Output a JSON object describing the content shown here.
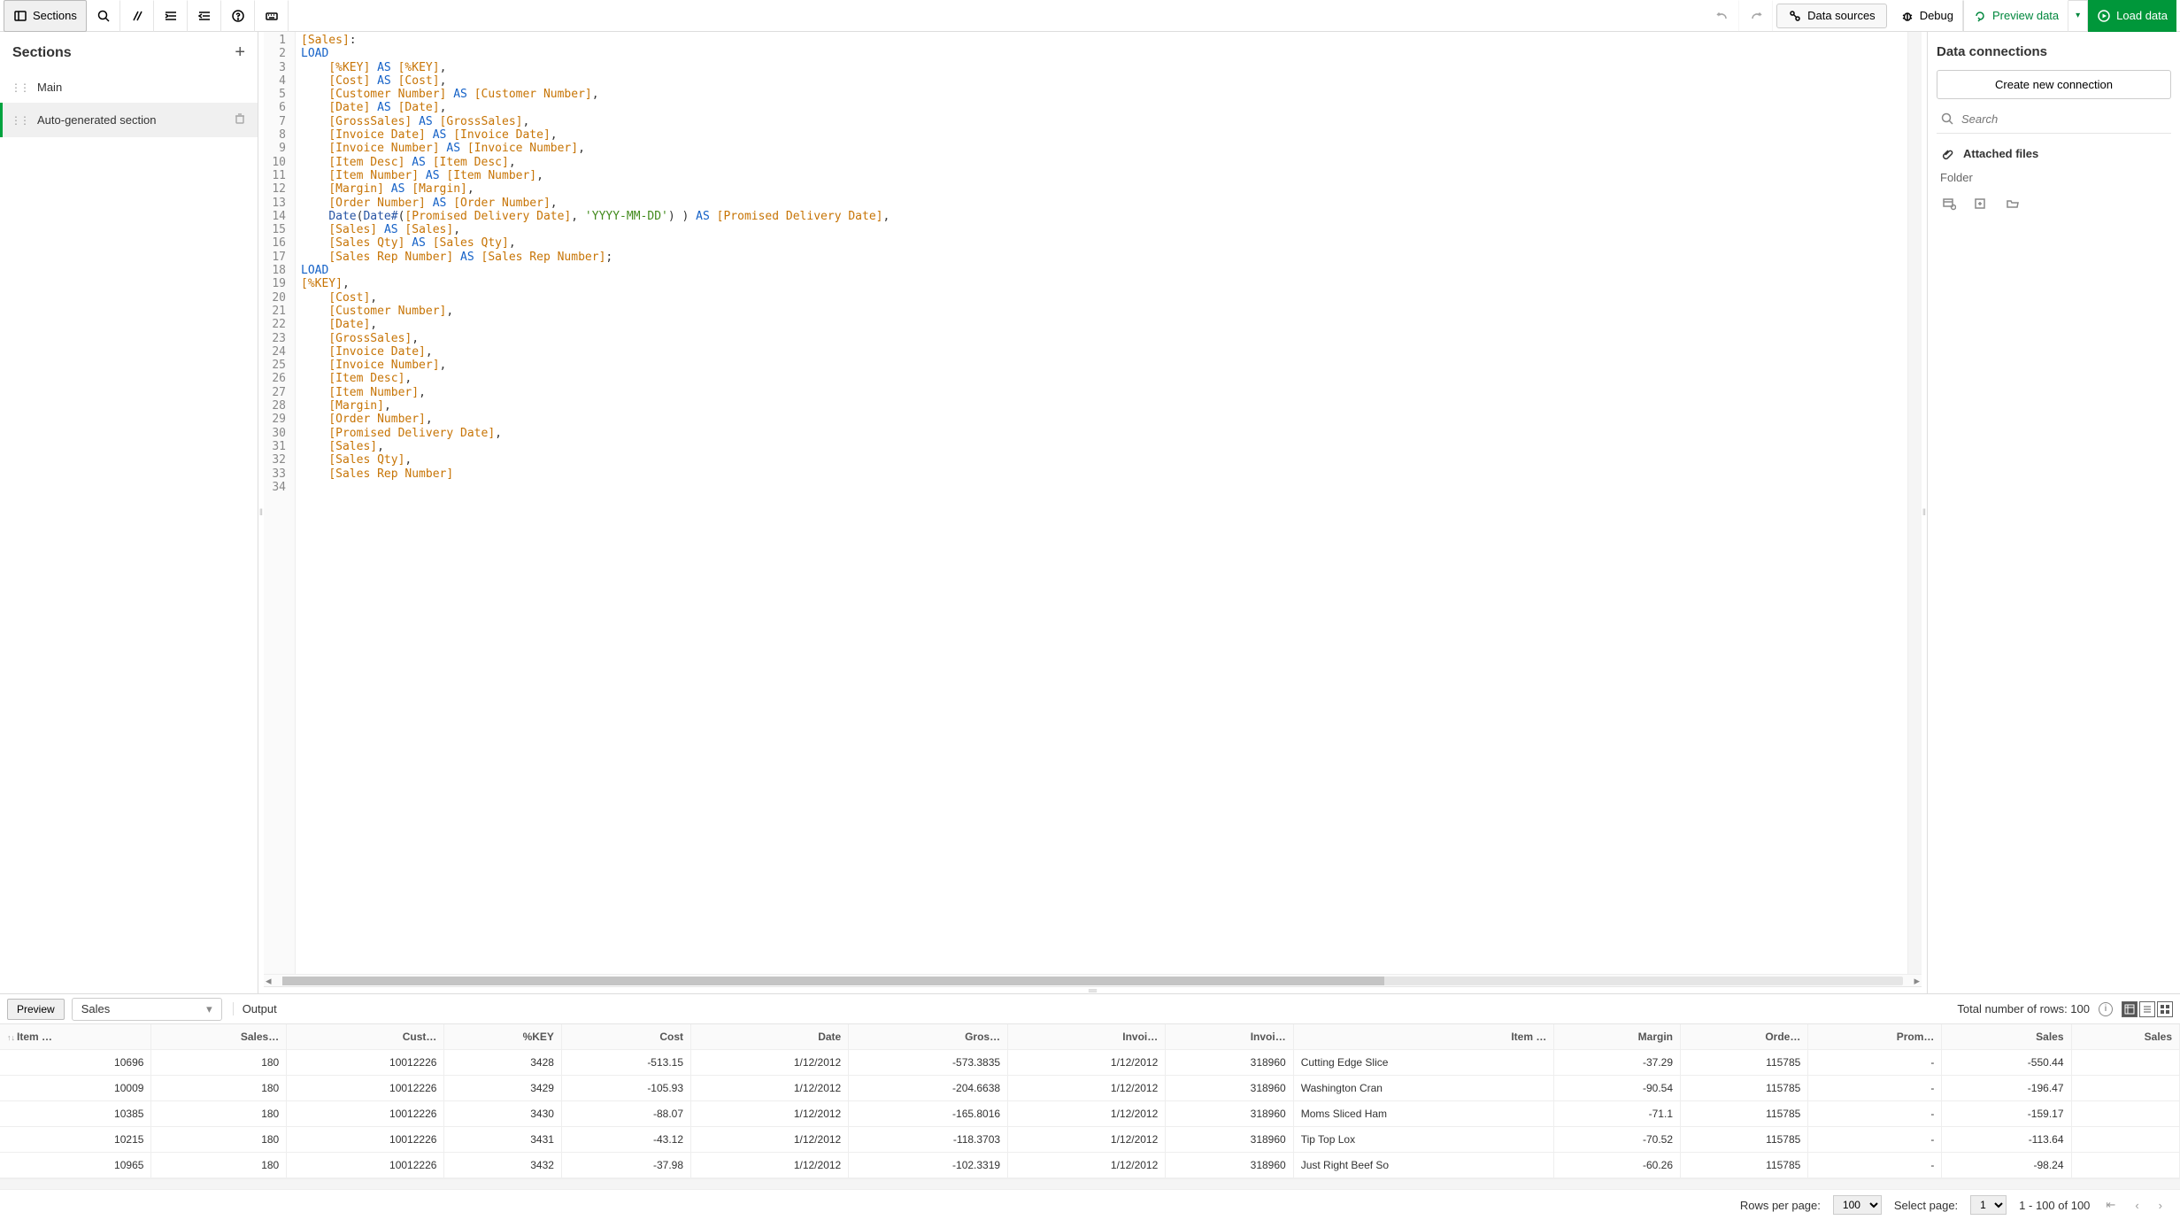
{
  "toolbar": {
    "sections_label": "Sections",
    "data_sources_label": "Data sources",
    "debug_label": "Debug",
    "preview_data_label": "Preview data",
    "load_data_label": "Load data"
  },
  "left_panel": {
    "title": "Sections",
    "items": [
      {
        "label": "Main",
        "selected": false
      },
      {
        "label": "Auto-generated section",
        "selected": true
      }
    ]
  },
  "right_panel": {
    "title": "Data connections",
    "create_btn": "Create new connection",
    "search_placeholder": "Search",
    "attached_label": "Attached files",
    "folder_label": "Folder"
  },
  "code": {
    "lines": [
      {
        "n": 1,
        "tokens": [
          {
            "t": "[Sales]",
            "c": "orange"
          },
          {
            "t": ":",
            "c": ""
          }
        ]
      },
      {
        "n": 2,
        "tokens": [
          {
            "t": "LOAD",
            "c": "blue"
          }
        ]
      },
      {
        "n": 3,
        "tokens": [
          {
            "t": "    ",
            "c": ""
          },
          {
            "t": "[%KEY]",
            "c": "orange"
          },
          {
            "t": " ",
            "c": ""
          },
          {
            "t": "AS",
            "c": "blue"
          },
          {
            "t": " ",
            "c": ""
          },
          {
            "t": "[%KEY]",
            "c": "orange"
          },
          {
            "t": ",",
            "c": ""
          }
        ]
      },
      {
        "n": 4,
        "tokens": [
          {
            "t": "    ",
            "c": ""
          },
          {
            "t": "[Cost]",
            "c": "orange"
          },
          {
            "t": " ",
            "c": ""
          },
          {
            "t": "AS",
            "c": "blue"
          },
          {
            "t": " ",
            "c": ""
          },
          {
            "t": "[Cost]",
            "c": "orange"
          },
          {
            "t": ",",
            "c": ""
          }
        ]
      },
      {
        "n": 5,
        "tokens": [
          {
            "t": "    ",
            "c": ""
          },
          {
            "t": "[Customer Number]",
            "c": "orange"
          },
          {
            "t": " ",
            "c": ""
          },
          {
            "t": "AS",
            "c": "blue"
          },
          {
            "t": " ",
            "c": ""
          },
          {
            "t": "[Customer Number]",
            "c": "orange"
          },
          {
            "t": ",",
            "c": ""
          }
        ]
      },
      {
        "n": 6,
        "tokens": [
          {
            "t": "    ",
            "c": ""
          },
          {
            "t": "[Date]",
            "c": "orange"
          },
          {
            "t": " ",
            "c": ""
          },
          {
            "t": "AS",
            "c": "blue"
          },
          {
            "t": " ",
            "c": ""
          },
          {
            "t": "[Date]",
            "c": "orange"
          },
          {
            "t": ",",
            "c": ""
          }
        ]
      },
      {
        "n": 7,
        "tokens": [
          {
            "t": "    ",
            "c": ""
          },
          {
            "t": "[GrossSales]",
            "c": "orange"
          },
          {
            "t": " ",
            "c": ""
          },
          {
            "t": "AS",
            "c": "blue"
          },
          {
            "t": " ",
            "c": ""
          },
          {
            "t": "[GrossSales]",
            "c": "orange"
          },
          {
            "t": ",",
            "c": ""
          }
        ]
      },
      {
        "n": 8,
        "tokens": [
          {
            "t": "    ",
            "c": ""
          },
          {
            "t": "[Invoice Date]",
            "c": "orange"
          },
          {
            "t": " ",
            "c": ""
          },
          {
            "t": "AS",
            "c": "blue"
          },
          {
            "t": " ",
            "c": ""
          },
          {
            "t": "[Invoice Date]",
            "c": "orange"
          },
          {
            "t": ",",
            "c": ""
          }
        ]
      },
      {
        "n": 9,
        "tokens": [
          {
            "t": "    ",
            "c": ""
          },
          {
            "t": "[Invoice Number]",
            "c": "orange"
          },
          {
            "t": " ",
            "c": ""
          },
          {
            "t": "AS",
            "c": "blue"
          },
          {
            "t": " ",
            "c": ""
          },
          {
            "t": "[Invoice Number]",
            "c": "orange"
          },
          {
            "t": ",",
            "c": ""
          }
        ]
      },
      {
        "n": 10,
        "tokens": [
          {
            "t": "    ",
            "c": ""
          },
          {
            "t": "[Item Desc]",
            "c": "orange"
          },
          {
            "t": " ",
            "c": ""
          },
          {
            "t": "AS",
            "c": "blue"
          },
          {
            "t": " ",
            "c": ""
          },
          {
            "t": "[Item Desc]",
            "c": "orange"
          },
          {
            "t": ",",
            "c": ""
          }
        ]
      },
      {
        "n": 11,
        "tokens": [
          {
            "t": "    ",
            "c": ""
          },
          {
            "t": "[Item Number]",
            "c": "orange"
          },
          {
            "t": " ",
            "c": ""
          },
          {
            "t": "AS",
            "c": "blue"
          },
          {
            "t": " ",
            "c": ""
          },
          {
            "t": "[Item Number]",
            "c": "orange"
          },
          {
            "t": ",",
            "c": ""
          }
        ]
      },
      {
        "n": 12,
        "tokens": [
          {
            "t": "    ",
            "c": ""
          },
          {
            "t": "[Margin]",
            "c": "orange"
          },
          {
            "t": " ",
            "c": ""
          },
          {
            "t": "AS",
            "c": "blue"
          },
          {
            "t": " ",
            "c": ""
          },
          {
            "t": "[Margin]",
            "c": "orange"
          },
          {
            "t": ",",
            "c": ""
          }
        ]
      },
      {
        "n": 13,
        "tokens": [
          {
            "t": "    ",
            "c": ""
          },
          {
            "t": "[Order Number]",
            "c": "orange"
          },
          {
            "t": " ",
            "c": ""
          },
          {
            "t": "AS",
            "c": "blue"
          },
          {
            "t": " ",
            "c": ""
          },
          {
            "t": "[Order Number]",
            "c": "orange"
          },
          {
            "t": ",",
            "c": ""
          }
        ]
      },
      {
        "n": 14,
        "tokens": [
          {
            "t": "    ",
            "c": ""
          },
          {
            "t": "Date",
            "c": "dblue"
          },
          {
            "t": "(",
            "c": ""
          },
          {
            "t": "Date#",
            "c": "dblue"
          },
          {
            "t": "(",
            "c": ""
          },
          {
            "t": "[Promised Delivery Date]",
            "c": "orange"
          },
          {
            "t": ", ",
            "c": ""
          },
          {
            "t": "'YYYY-MM-DD'",
            "c": "green"
          },
          {
            "t": ") ) ",
            "c": ""
          },
          {
            "t": "AS",
            "c": "blue"
          },
          {
            "t": " ",
            "c": ""
          },
          {
            "t": "[Promised Delivery Date]",
            "c": "orange"
          },
          {
            "t": ",",
            "c": ""
          }
        ]
      },
      {
        "n": 15,
        "tokens": [
          {
            "t": "    ",
            "c": ""
          },
          {
            "t": "[Sales]",
            "c": "orange"
          },
          {
            "t": " ",
            "c": ""
          },
          {
            "t": "AS",
            "c": "blue"
          },
          {
            "t": " ",
            "c": ""
          },
          {
            "t": "[Sales]",
            "c": "orange"
          },
          {
            "t": ",",
            "c": ""
          }
        ]
      },
      {
        "n": 16,
        "tokens": [
          {
            "t": "    ",
            "c": ""
          },
          {
            "t": "[Sales Qty]",
            "c": "orange"
          },
          {
            "t": " ",
            "c": ""
          },
          {
            "t": "AS",
            "c": "blue"
          },
          {
            "t": " ",
            "c": ""
          },
          {
            "t": "[Sales Qty]",
            "c": "orange"
          },
          {
            "t": ",",
            "c": ""
          }
        ]
      },
      {
        "n": 17,
        "tokens": [
          {
            "t": "    ",
            "c": ""
          },
          {
            "t": "[Sales Rep Number]",
            "c": "orange"
          },
          {
            "t": " ",
            "c": ""
          },
          {
            "t": "AS",
            "c": "blue"
          },
          {
            "t": " ",
            "c": ""
          },
          {
            "t": "[Sales Rep Number]",
            "c": "orange"
          },
          {
            "t": ";",
            "c": ""
          }
        ]
      },
      {
        "n": 18,
        "tokens": [
          {
            "t": "LOAD",
            "c": "blue"
          }
        ]
      },
      {
        "n": 19,
        "tokens": [
          {
            "t": "[%KEY]",
            "c": "orange"
          },
          {
            "t": ",",
            "c": ""
          }
        ]
      },
      {
        "n": 20,
        "tokens": [
          {
            "t": "    ",
            "c": ""
          },
          {
            "t": "[Cost]",
            "c": "orange"
          },
          {
            "t": ",",
            "c": ""
          }
        ]
      },
      {
        "n": 21,
        "tokens": [
          {
            "t": "    ",
            "c": ""
          },
          {
            "t": "[Customer Number]",
            "c": "orange"
          },
          {
            "t": ",",
            "c": ""
          }
        ]
      },
      {
        "n": 22,
        "tokens": [
          {
            "t": "    ",
            "c": ""
          },
          {
            "t": "[Date]",
            "c": "orange"
          },
          {
            "t": ",",
            "c": ""
          }
        ]
      },
      {
        "n": 23,
        "tokens": [
          {
            "t": "    ",
            "c": ""
          },
          {
            "t": "[GrossSales]",
            "c": "orange"
          },
          {
            "t": ",",
            "c": ""
          }
        ]
      },
      {
        "n": 24,
        "tokens": [
          {
            "t": "    ",
            "c": ""
          },
          {
            "t": "[Invoice Date]",
            "c": "orange"
          },
          {
            "t": ",",
            "c": ""
          }
        ]
      },
      {
        "n": 25,
        "tokens": [
          {
            "t": "    ",
            "c": ""
          },
          {
            "t": "[Invoice Number]",
            "c": "orange"
          },
          {
            "t": ",",
            "c": ""
          }
        ]
      },
      {
        "n": 26,
        "tokens": [
          {
            "t": "    ",
            "c": ""
          },
          {
            "t": "[Item Desc]",
            "c": "orange"
          },
          {
            "t": ",",
            "c": ""
          }
        ]
      },
      {
        "n": 27,
        "tokens": [
          {
            "t": "    ",
            "c": ""
          },
          {
            "t": "[Item Number]",
            "c": "orange"
          },
          {
            "t": ",",
            "c": ""
          }
        ]
      },
      {
        "n": 28,
        "tokens": [
          {
            "t": "    ",
            "c": ""
          },
          {
            "t": "[Margin]",
            "c": "orange"
          },
          {
            "t": ",",
            "c": ""
          }
        ]
      },
      {
        "n": 29,
        "tokens": [
          {
            "t": "    ",
            "c": ""
          },
          {
            "t": "[Order Number]",
            "c": "orange"
          },
          {
            "t": ",",
            "c": ""
          }
        ]
      },
      {
        "n": 30,
        "tokens": [
          {
            "t": "    ",
            "c": ""
          },
          {
            "t": "[Promised Delivery Date]",
            "c": "orange"
          },
          {
            "t": ",",
            "c": ""
          }
        ]
      },
      {
        "n": 31,
        "tokens": [
          {
            "t": "    ",
            "c": ""
          },
          {
            "t": "[Sales]",
            "c": "orange"
          },
          {
            "t": ",",
            "c": ""
          }
        ]
      },
      {
        "n": 32,
        "tokens": [
          {
            "t": "    ",
            "c": ""
          },
          {
            "t": "[Sales Qty]",
            "c": "orange"
          },
          {
            "t": ",",
            "c": ""
          }
        ]
      },
      {
        "n": 33,
        "tokens": [
          {
            "t": "    ",
            "c": ""
          },
          {
            "t": "[Sales Rep Number]",
            "c": "orange"
          }
        ]
      },
      {
        "n": 34,
        "tokens": [
          {
            "t": "",
            "c": ""
          }
        ]
      }
    ]
  },
  "preview": {
    "preview_btn": "Preview",
    "table_selected": "Sales",
    "output_label": "Output",
    "rows_info": "Total number of rows: 100",
    "columns": [
      "Item …",
      "Sales…",
      "Cust…",
      "%KEY",
      "Cost",
      "Date",
      "Gros…",
      "Invoi…",
      "Invoi…",
      "Item …",
      "Margin",
      "Orde…",
      "Prom…",
      "Sales",
      "Sales"
    ],
    "rows": [
      [
        "10696",
        "180",
        "10012226",
        "3428",
        "-513.15",
        "1/12/2012",
        "-573.3835",
        "1/12/2012",
        "318960",
        "Cutting Edge Slice",
        "-37.29",
        "115785",
        "-",
        "-550.44",
        ""
      ],
      [
        "10009",
        "180",
        "10012226",
        "3429",
        "-105.93",
        "1/12/2012",
        "-204.6638",
        "1/12/2012",
        "318960",
        "Washington Cran",
        "-90.54",
        "115785",
        "-",
        "-196.47",
        ""
      ],
      [
        "10385",
        "180",
        "10012226",
        "3430",
        "-88.07",
        "1/12/2012",
        "-165.8016",
        "1/12/2012",
        "318960",
        "Moms Sliced Ham",
        "-71.1",
        "115785",
        "-",
        "-159.17",
        ""
      ],
      [
        "10215",
        "180",
        "10012226",
        "3431",
        "-43.12",
        "1/12/2012",
        "-118.3703",
        "1/12/2012",
        "318960",
        "Tip Top Lox",
        "-70.52",
        "115785",
        "-",
        "-113.64",
        ""
      ],
      [
        "10965",
        "180",
        "10012226",
        "3432",
        "-37.98",
        "1/12/2012",
        "-102.3319",
        "1/12/2012",
        "318960",
        "Just Right Beef So",
        "-60.26",
        "115785",
        "-",
        "-98.24",
        ""
      ]
    ]
  },
  "pager": {
    "rows_per_page_label": "Rows per page:",
    "rows_per_page_value": "100",
    "select_page_label": "Select page:",
    "select_page_value": "1",
    "range_label": "1 - 100 of 100"
  }
}
